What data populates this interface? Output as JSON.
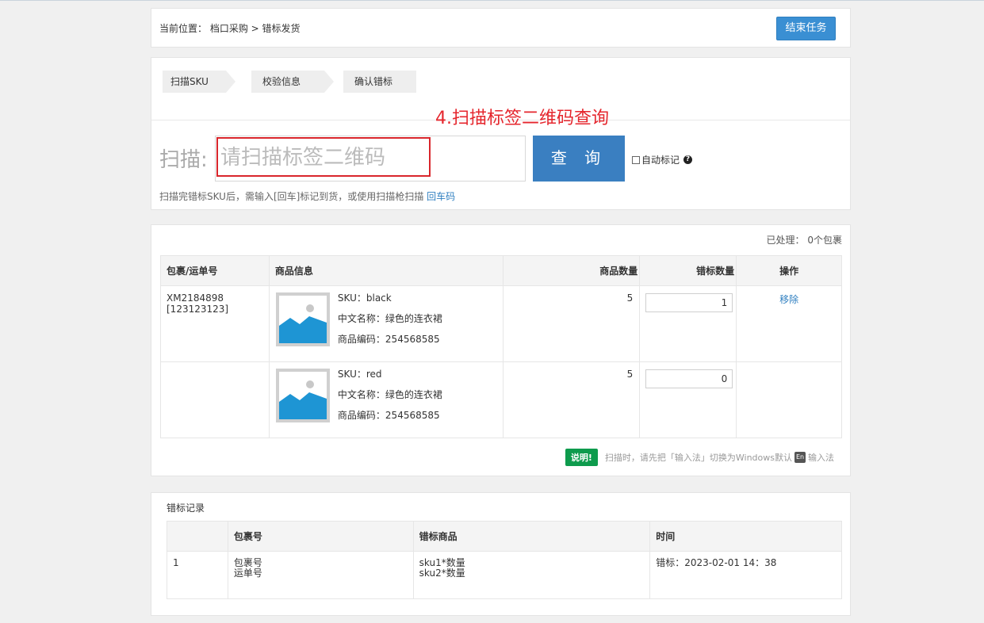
{
  "breadcrumb": {
    "text": "当前位置：  档口采购 > 错标发货"
  },
  "header": {
    "end_task_label": "结束任务"
  },
  "steps": [
    {
      "label": "扫描SKU"
    },
    {
      "label": "校验信息"
    },
    {
      "label": "确认错标"
    }
  ],
  "annotation": "4.扫描标签二维码查询",
  "scan": {
    "label": "扫描:",
    "placeholder": "请扫描标签二维码",
    "query_label": "查 询",
    "auto_mark_label": "自动标记",
    "hint_text": "扫描完错标SKU后，需输入[回车]标记到货，或使用扫描枪扫描 ",
    "hint_link": "回车码"
  },
  "products": {
    "processed_text": "已处理：   0个包裹",
    "headers": {
      "pkg": "包裹/运单号",
      "info": "商品信息",
      "qty": "商品数量",
      "wrong_qty": "错标数量",
      "op": "操作"
    },
    "rows": [
      {
        "pkg_no": "XM2184898",
        "tracking": "[123123123]",
        "sku": "SKU：black",
        "cn_name": "中文名称：绿色的连衣裙",
        "code": "商品编码：254568585",
        "qty": "5",
        "wrong_qty": "1",
        "op": "移除"
      },
      {
        "pkg_no": "",
        "tracking": "",
        "sku": "SKU：red",
        "cn_name": "中文名称：绿色的连衣裙",
        "code": "商品编码：254568585",
        "qty": "5",
        "wrong_qty": "0",
        "op": ""
      }
    ],
    "note_badge": "说明!",
    "note_text_a": "扫描时，请先把「输入法」切换为Windows默认",
    "note_icon_text": "En",
    "note_text_b": "输入法"
  },
  "records": {
    "title": "错标记录",
    "headers": {
      "idx": "",
      "pkg": "包裹号",
      "goods": "错标商品",
      "time": "时间"
    },
    "rows": [
      {
        "idx": "1",
        "pkg_line1": "包裹号",
        "pkg_line2": "运单号",
        "goods_line1": "sku1*数量",
        "goods_line2": "sku2*数量",
        "time": "错标：2023-02-01 14：38"
      }
    ]
  },
  "colors": {
    "primary": "#3a7fc1",
    "annotation_red": "#e5262d",
    "badge_green": "#0e9b4d",
    "link_blue": "#2f7fc0"
  }
}
